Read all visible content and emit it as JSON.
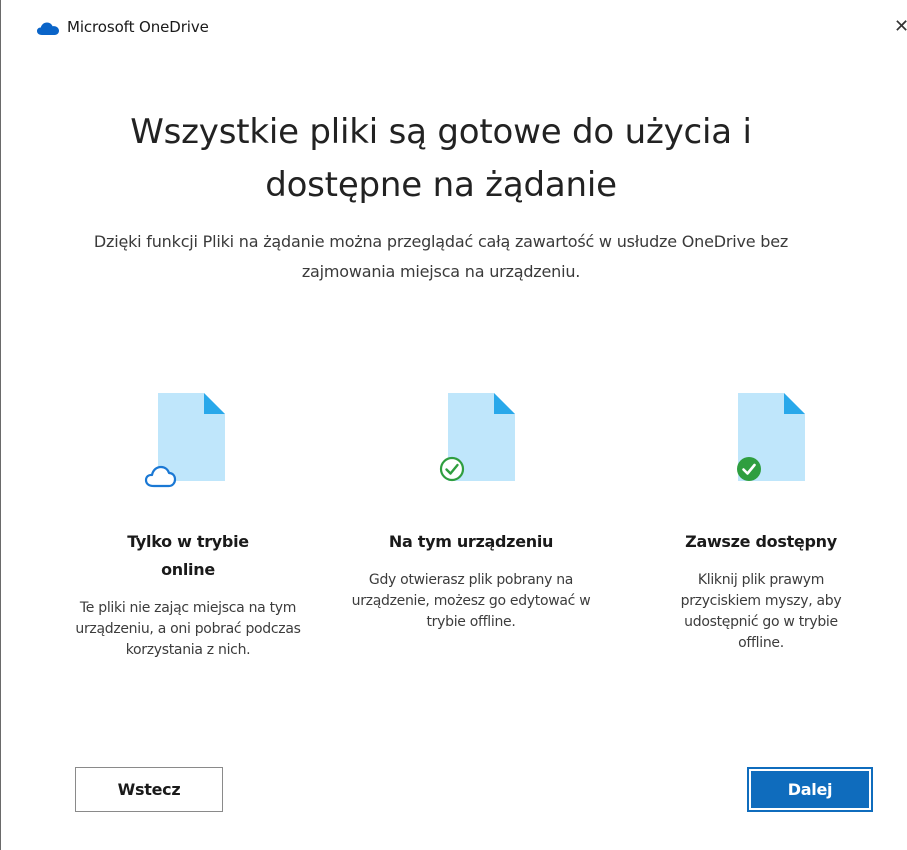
{
  "window": {
    "title": "Microsoft OneDrive",
    "close_glyph": "✕"
  },
  "main": {
    "headline": "Wszystkie pliki są gotowe do użycia i dostępne na żądanie",
    "subtitle": "Dzięki funkcji Pliki na żądanie można przeglądać całą zawartość w usłudze OneDrive bez zajmowania miejsca na urządzeniu."
  },
  "features": [
    {
      "title": "Tylko w trybie online",
      "description": "Te pliki nie zając miejsca na tym urządzeniu, a oni pobrać podczas korzystania z nich.",
      "icon": "online-only-file-icon"
    },
    {
      "title": "Na tym urządzeniu",
      "description": "Gdy otwierasz plik pobrany na urządzenie, możesz go edytować w trybie offline.",
      "icon": "locally-available-file-icon"
    },
    {
      "title": "Zawsze dostępny",
      "description": "Kliknij plik prawym przyciskiem myszy, aby udostępnić go w trybie offline.",
      "icon": "always-available-file-icon"
    }
  ],
  "buttons": {
    "back": "Wstecz",
    "next": "Dalej"
  },
  "colors": {
    "file_body": "#bfe6fb",
    "file_fold": "#29a8ea",
    "cloud_stroke": "#1a78d4",
    "check_green": "#2f9e3f",
    "primary_button": "#0f6cbd"
  }
}
